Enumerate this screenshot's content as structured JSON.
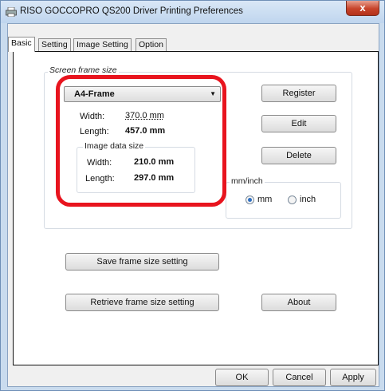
{
  "window": {
    "title": "RISO GOCCOPRO QS200 Driver Printing Preferences",
    "close_glyph": "x"
  },
  "tabs": [
    "Basic",
    "Setting",
    "Image Setting",
    "Option"
  ],
  "screen_frame": {
    "group_label": "Screen frame size",
    "selected_frame": "A4-Frame",
    "width_label": "Width:",
    "width_value": "370.0 mm",
    "length_label": "Length:",
    "length_value": "457.0 mm"
  },
  "image_data": {
    "group_label": "Image data size",
    "width_label": "Width:",
    "width_value": "210.0 mm",
    "length_label": "Length:",
    "length_value": "297.0 mm"
  },
  "units": {
    "group_label": "mm/inch",
    "options": [
      "mm",
      "inch"
    ],
    "selected": "mm"
  },
  "buttons": {
    "register": "Register",
    "edit": "Edit",
    "delete": "Delete",
    "save_frame": "Save frame size setting",
    "retrieve_frame": "Retrieve frame size setting",
    "about": "About",
    "ok": "OK",
    "cancel": "Cancel",
    "apply": "Apply"
  },
  "colors": {
    "highlight": "#e8141e",
    "title_bar": "#c9dbee",
    "close_button": "#c7432a"
  }
}
